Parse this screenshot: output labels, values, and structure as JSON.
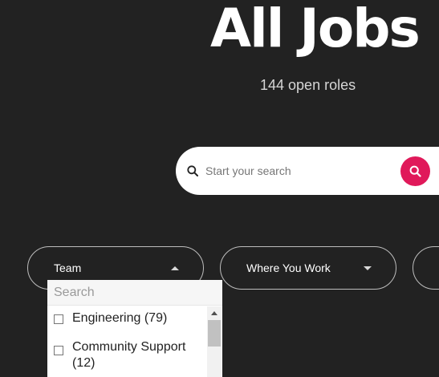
{
  "header": {
    "title": "All Jobs",
    "subtitle": "144 open roles"
  },
  "search": {
    "placeholder": "Start your search",
    "icon": "search-icon",
    "submit_icon": "search-icon",
    "accent_color": "#e0195a"
  },
  "filters": [
    {
      "label": "Team",
      "expanded": true
    },
    {
      "label": "Where You Work",
      "expanded": false
    }
  ],
  "team_dropdown": {
    "search_placeholder": "Search",
    "options": [
      {
        "label": "Engineering (79)",
        "checked": false
      },
      {
        "label": "Community Support (12)",
        "checked": false
      }
    ]
  },
  "colors": {
    "background": "#222222",
    "panel": "#ffffff"
  }
}
